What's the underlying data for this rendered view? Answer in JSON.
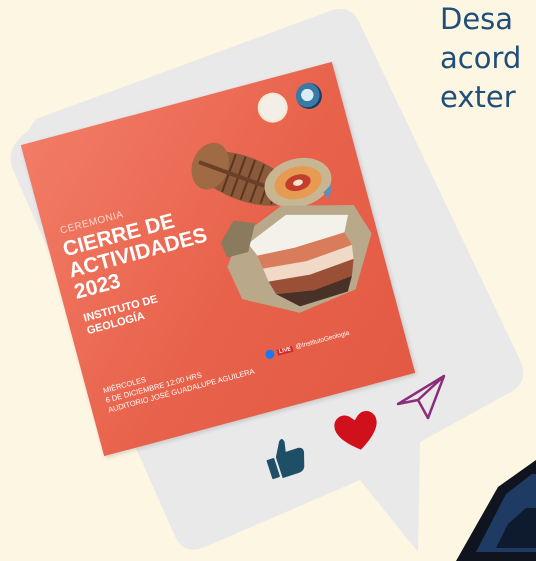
{
  "background_text": {
    "lines": [
      "Desa",
      "acord",
      "exter"
    ]
  },
  "poster": {
    "eyebrow": "CEREMONIA",
    "title_lines": [
      "CIERRE DE",
      "ACTIVIDADES",
      "2023"
    ],
    "institute_lines": [
      "INSTITUTO DE",
      "GEOLOGÍA"
    ],
    "date_lines": [
      "MIÉRCOLES",
      "6 DE DICIEMBRE 12:00 HRS",
      "AUDITORIO JOSÉ GUADALUPE AGUILERA"
    ],
    "live_label": "LIVE",
    "live_handle": "@InstitutoGeologia"
  },
  "colors": {
    "poster_bg": "#e8624b",
    "bubble_bg": "#e9e9e9",
    "heart": "#d0101a",
    "thumb": "#1f4e67",
    "send": "#8a2d7a",
    "text_blue": "#1f4e79"
  }
}
